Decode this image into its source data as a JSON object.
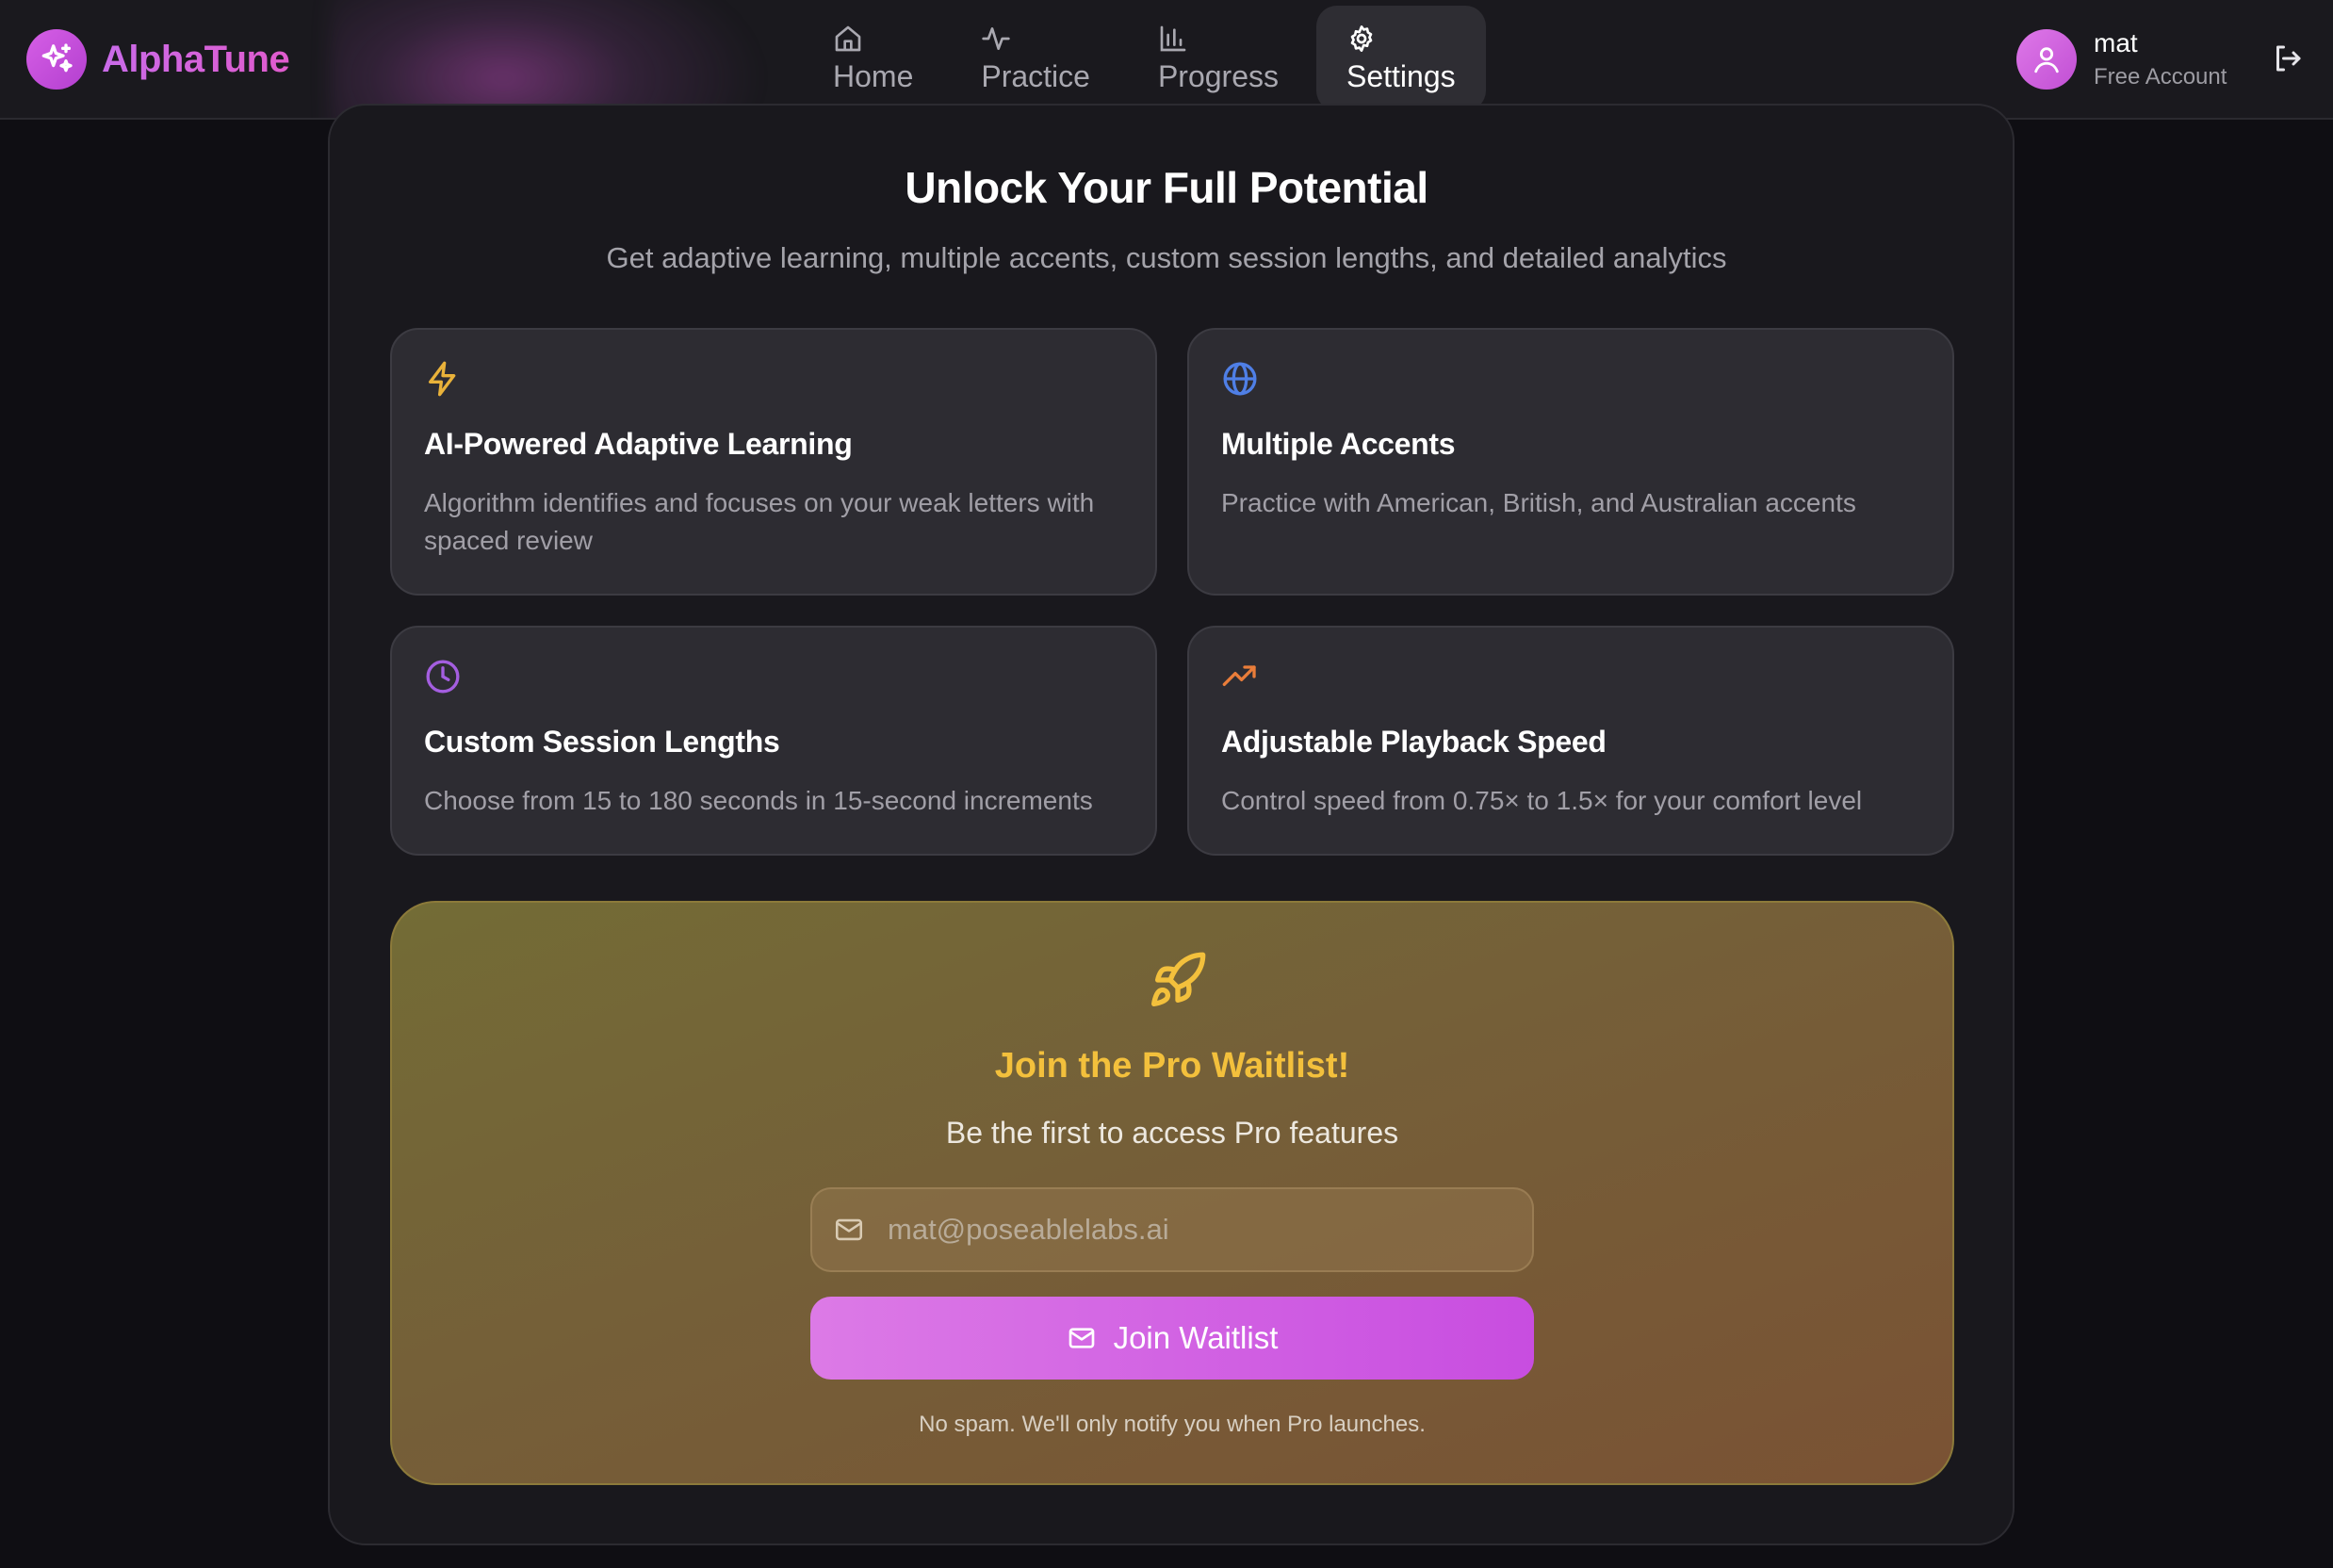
{
  "brand": {
    "name": "AlphaTune",
    "logo_icon": "sparkles-icon"
  },
  "nav": {
    "items": [
      {
        "label": "Home",
        "icon": "home-icon",
        "active": false
      },
      {
        "label": "Practice",
        "icon": "activity-icon",
        "active": false
      },
      {
        "label": "Progress",
        "icon": "bar-chart-icon",
        "active": false
      },
      {
        "label": "Settings",
        "icon": "gear-icon",
        "active": true
      }
    ]
  },
  "user": {
    "name": "mat",
    "tier": "Free Account",
    "avatar_icon": "user-icon",
    "logout_icon": "logout-icon"
  },
  "upgrade": {
    "title": "Unlock Your Full Potential",
    "subtitle": "Get adaptive learning, multiple accents, custom session lengths, and detailed analytics",
    "features": [
      {
        "icon": "lightning-icon",
        "icon_color": "#e9b23a",
        "title": "AI-Powered Adaptive Learning",
        "description": "Algorithm identifies and focuses on your weak letters with spaced review"
      },
      {
        "icon": "globe-icon",
        "icon_color": "#4f7fe6",
        "title": "Multiple Accents",
        "description": "Practice with American, British, and Australian accents"
      },
      {
        "icon": "clock-icon",
        "icon_color": "#a45ee0",
        "title": "Custom Session Lengths",
        "description": "Choose from 15 to 180 seconds in 15-second increments"
      },
      {
        "icon": "trending-up-icon",
        "icon_color": "#e97d3a",
        "title": "Adjustable Playback Speed",
        "description": "Control speed from 0.75× to 1.5× for your comfort level"
      }
    ]
  },
  "waitlist": {
    "icon": "rocket-icon",
    "title": "Join the Pro Waitlist!",
    "subtitle": "Be the first to access Pro features",
    "email_placeholder": "mat@poseablelabs.ai",
    "email_value": "",
    "button_label": "Join Waitlist",
    "fine_print": "No spam. We'll only notify you when Pro launches."
  },
  "colors": {
    "accent_purple": "#c84de0",
    "accent_gold": "#f3c03c",
    "background": "#0f0e13",
    "card": "#2d2c32"
  }
}
